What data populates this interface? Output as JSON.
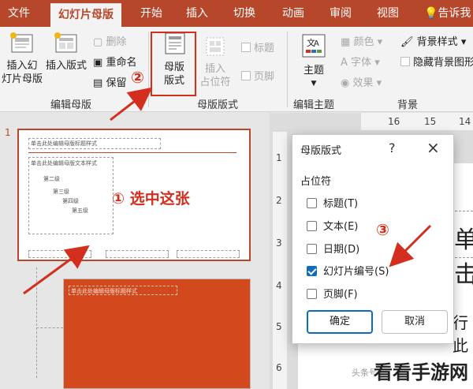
{
  "tabs": [
    "文件",
    "幻灯片母版",
    "开始",
    "插入",
    "切换",
    "动画",
    "审阅",
    "视图",
    "告诉我我"
  ],
  "ribbon": {
    "insert_master": [
      "插入幻",
      "灯片母版"
    ],
    "insert_layout": "插入版式",
    "delete": "删除",
    "rename": "重命名",
    "preserve": "保留",
    "master_layout": [
      "母版",
      "版式"
    ],
    "insert_placeholder": [
      "插入",
      "占位符"
    ],
    "title_check": "标题",
    "footer_check": "页脚",
    "theme": "主题",
    "colors": "颜色",
    "fonts": "字体",
    "effects": "效果",
    "background_styles": "背景样式",
    "hide_background": "隐藏背景图形",
    "groups": [
      "编辑母版",
      "母版版式",
      "编辑主题",
      "背景"
    ]
  },
  "annotations": {
    "step1": "① 选中这张",
    "step2": "②",
    "step3": "③"
  },
  "thumbnails": {
    "slide_number": "1",
    "title_placeholder": "单击此处编辑母版标题样式",
    "body_lines": [
      "单击此处编辑母版文本样式",
      "第二级",
      "第三级",
      "第四级",
      "第五级"
    ],
    "footer_date": "",
    "footer_center": "",
    "footer_num": "",
    "layout_title": "单击此处编辑母版标题样式"
  },
  "ruler": {
    "top": [
      "16",
      "15",
      "14"
    ],
    "left": [
      "1",
      "2",
      "3",
      "4",
      "5",
      "6"
    ]
  },
  "canvas": {
    "text_partial_1": "单击",
    "text_partial_2": "行此"
  },
  "dialog": {
    "title": "母版版式",
    "help": "?",
    "close": "×",
    "section": "占位符",
    "options": [
      {
        "label": "标题(T)",
        "checked": false
      },
      {
        "label": "文本(E)",
        "checked": false
      },
      {
        "label": "日期(D)",
        "checked": false
      },
      {
        "label": "幻灯片编号(S)",
        "checked": true
      },
      {
        "label": "页脚(F)",
        "checked": false
      }
    ],
    "ok": "确定",
    "cancel": "取消"
  },
  "watermark": "看看手游网",
  "watermark_small": "头条号"
}
